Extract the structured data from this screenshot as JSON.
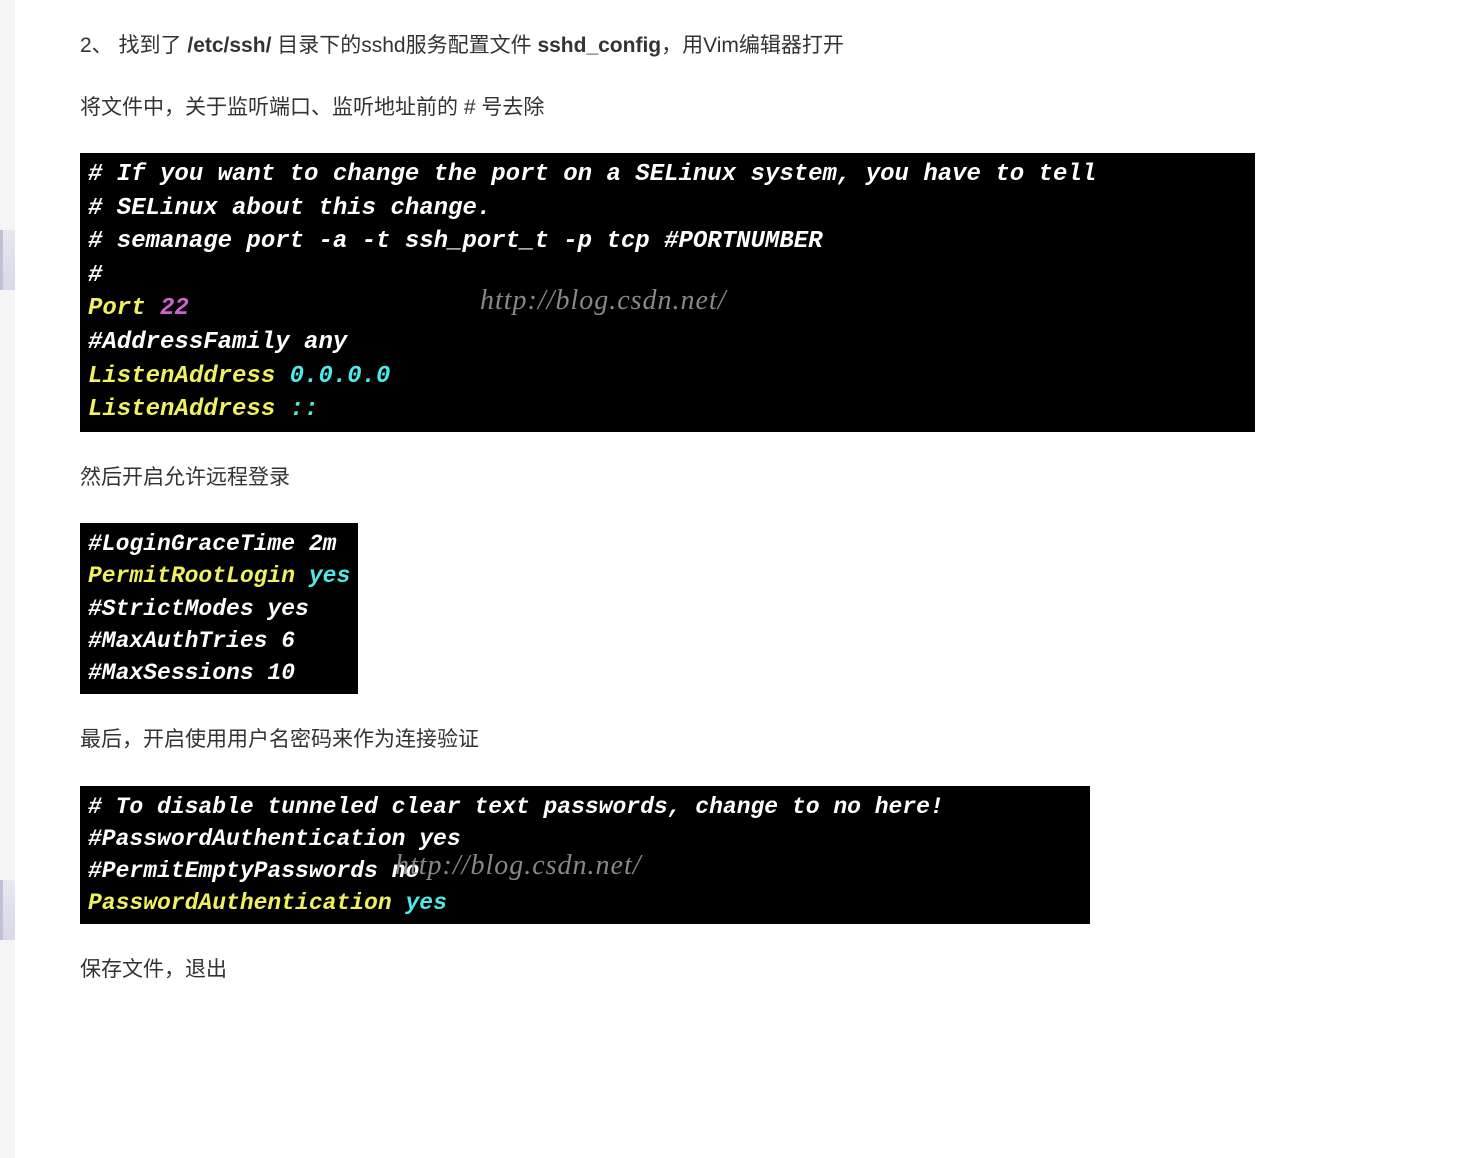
{
  "para1": {
    "prefix": "2、  找到了  ",
    "bold1": "/etc/ssh/",
    "mid": "  目录下的sshd服务配置文件 ",
    "bold2": "sshd_config",
    "suffix": "，用Vim编辑器打开"
  },
  "para2": "将文件中，关于监听端口、监听地址前的 # 号去除",
  "terminal1": {
    "lines": [
      {
        "segments": [
          {
            "cls": "t-white",
            "text": "# If you want to change the port on a SELinux system, you have to tell"
          }
        ]
      },
      {
        "segments": [
          {
            "cls": "t-white",
            "text": "# SELinux about this change."
          }
        ]
      },
      {
        "segments": [
          {
            "cls": "t-white",
            "text": "# semanage port -a -t ssh_port_t -p tcp #PORTNUMBER"
          }
        ]
      },
      {
        "segments": [
          {
            "cls": "t-white",
            "text": "#"
          }
        ]
      },
      {
        "segments": [
          {
            "cls": "t-yellow",
            "text": "Port"
          },
          {
            "cls": "t-purple",
            "text": " 22"
          }
        ]
      },
      {
        "segments": [
          {
            "cls": "t-white",
            "text": "#AddressFamily any"
          }
        ]
      },
      {
        "segments": [
          {
            "cls": "t-yellow",
            "text": "ListenAddress"
          },
          {
            "cls": "t-cyan",
            "text": " 0.0.0.0"
          }
        ]
      },
      {
        "segments": [
          {
            "cls": "t-yellow",
            "text": "ListenAddress"
          },
          {
            "cls": "t-cyan",
            "text": " ::"
          }
        ]
      }
    ],
    "watermark": "http://blog.csdn.net/"
  },
  "para3": "然后开启允许远程登录",
  "terminal2": {
    "lines": [
      {
        "segments": [
          {
            "cls": "t-white",
            "text": "#LoginGraceTime 2m"
          }
        ]
      },
      {
        "segments": [
          {
            "cls": "t-yellow",
            "text": "PermitRootLogin"
          },
          {
            "cls": "t-cyan",
            "text": " yes"
          }
        ]
      },
      {
        "segments": [
          {
            "cls": "t-white",
            "text": "#StrictModes yes"
          }
        ]
      },
      {
        "segments": [
          {
            "cls": "t-white",
            "text": "#MaxAuthTries 6"
          }
        ]
      },
      {
        "segments": [
          {
            "cls": "t-white",
            "text": "#MaxSessions 10"
          }
        ]
      }
    ]
  },
  "para4": "最后，开启使用用户名密码来作为连接验证",
  "terminal3": {
    "lines": [
      {
        "segments": [
          {
            "cls": "t-white",
            "text": "# To disable tunneled clear text passwords, change to no here!"
          }
        ]
      },
      {
        "segments": [
          {
            "cls": "t-white",
            "text": "#PasswordAuthentication yes"
          }
        ]
      },
      {
        "segments": [
          {
            "cls": "t-white",
            "text": "#PermitEmptyPasswords no"
          }
        ]
      },
      {
        "segments": [
          {
            "cls": "t-yellow",
            "text": "PasswordAuthentication"
          },
          {
            "cls": "t-cyan",
            "text": " yes"
          }
        ]
      }
    ],
    "watermark": "http://blog.csdn.net/"
  },
  "para5": "保存文件，退出"
}
